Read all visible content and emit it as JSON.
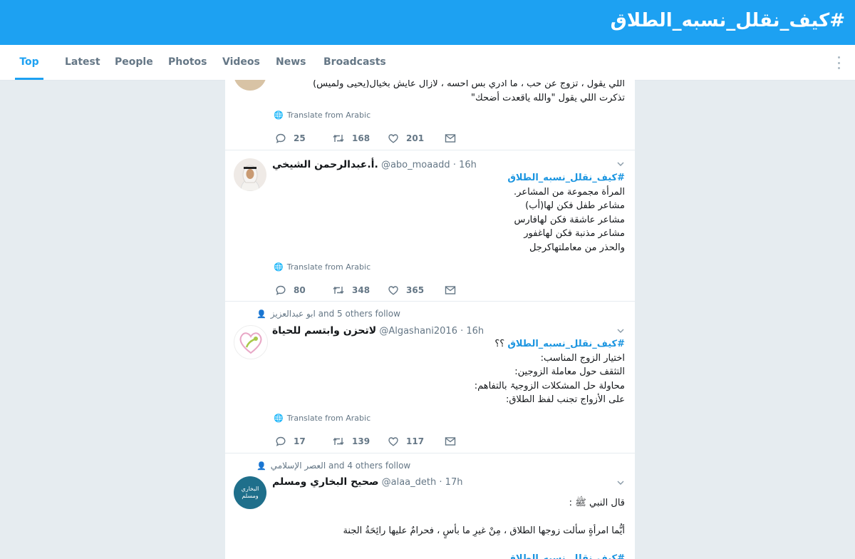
{
  "header": {
    "title": "#كيف_نقلل_نسبه_الطلاق"
  },
  "tabs": [
    {
      "label": "Top"
    },
    {
      "label": "Latest"
    },
    {
      "label": "People"
    },
    {
      "label": "Photos"
    },
    {
      "label": "Videos"
    },
    {
      "label": "News"
    },
    {
      "label": "Broadcasts"
    }
  ],
  "tweets": [
    {
      "text_lines": [
        "اللي يقول ، تزوج عن حب ، ما ادري بس احسه ، لازال عايش بخيال(يحيى ولميس)",
        "تذكرت اللي يقول \"والله ياقعدت أضحك\""
      ],
      "translate": "Translate from Arabic",
      "replies": "25",
      "retweets": "168",
      "likes": "201"
    },
    {
      "name": "أ.عبدالرحمن الشيخي.",
      "handle": "@abo_moaadd",
      "time": "16h",
      "hashtag": "#كيف_نقلل_نسبه_الطلاق",
      "text_lines": [
        "المرأة مجموعة من المشاعر.",
        "مشاعر طفل فكن لها(أب)",
        "مشاعر عاشقة فكن لهافارس",
        "مشاعر مذنبة فكن لهاغفور",
        "والحذر من معاملتهاكرجل"
      ],
      "translate": "Translate from Arabic",
      "replies": "80",
      "retweets": "348",
      "likes": "365"
    },
    {
      "context": "ابو عبدالعزيز and 5 others follow",
      "name": "لاتحزن وابتسم للحياة",
      "handle": "@Algashani2016",
      "time": "16h",
      "hashtag": "#كيف_نقلل_نسبه_الطلاق",
      "hashtag_suffix": "؟؟",
      "text_lines": [
        "اختيار الزوج المناسب:",
        "التثقف حول معاملة الزوجين:",
        "محاولة حل المشكلات الزوجيۃ بالتفاهم:",
        "على الأزواج تجنب لفظ الطلاق:"
      ],
      "translate": "Translate from Arabic",
      "replies": "17",
      "retweets": "139",
      "likes": "117"
    },
    {
      "context": "العصر الإسلامي and 4 others follow",
      "name": "صحيح البخاري ومسلم",
      "handle": "@alaa_deth",
      "time": "17h",
      "avatar_text": "البخاري ومسلم",
      "text_lines": [
        "قال النبي ﷺ :",
        "",
        "أيُّما امرأةٍ سألت زوجها الطلاق ، مِنْ غيرِ ما بأسٍ ، فحرامٌ عليها رائِحَةُ الجنة"
      ],
      "hashtag": "#كيف_نقلل_نسبه_الطلاق"
    }
  ],
  "colors": {
    "accent": "#1da1f2",
    "link": "#1b95e0",
    "muted": "#657786",
    "background": "#e6ecf0"
  }
}
